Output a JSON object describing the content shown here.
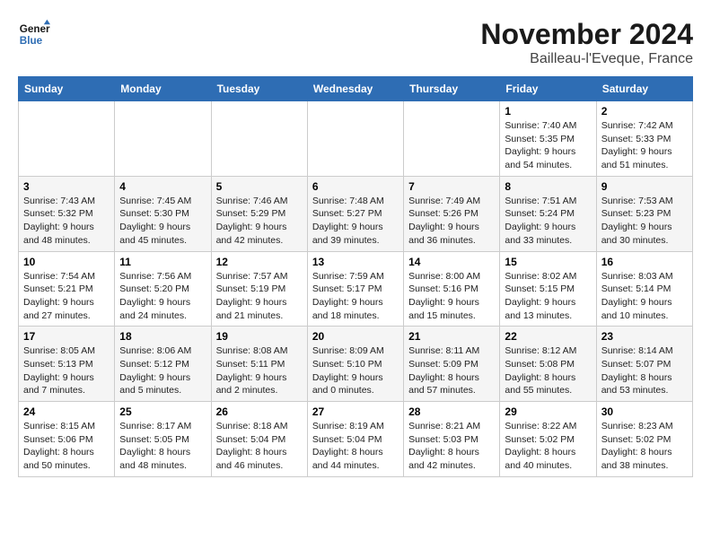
{
  "header": {
    "logo_line1": "General",
    "logo_line2": "Blue",
    "month": "November 2024",
    "location": "Bailleau-l'Eveque, France"
  },
  "weekdays": [
    "Sunday",
    "Monday",
    "Tuesday",
    "Wednesday",
    "Thursday",
    "Friday",
    "Saturday"
  ],
  "weeks": [
    [
      {
        "day": "",
        "info": ""
      },
      {
        "day": "",
        "info": ""
      },
      {
        "day": "",
        "info": ""
      },
      {
        "day": "",
        "info": ""
      },
      {
        "day": "",
        "info": ""
      },
      {
        "day": "1",
        "info": "Sunrise: 7:40 AM\nSunset: 5:35 PM\nDaylight: 9 hours and 54 minutes."
      },
      {
        "day": "2",
        "info": "Sunrise: 7:42 AM\nSunset: 5:33 PM\nDaylight: 9 hours and 51 minutes."
      }
    ],
    [
      {
        "day": "3",
        "info": "Sunrise: 7:43 AM\nSunset: 5:32 PM\nDaylight: 9 hours and 48 minutes."
      },
      {
        "day": "4",
        "info": "Sunrise: 7:45 AM\nSunset: 5:30 PM\nDaylight: 9 hours and 45 minutes."
      },
      {
        "day": "5",
        "info": "Sunrise: 7:46 AM\nSunset: 5:29 PM\nDaylight: 9 hours and 42 minutes."
      },
      {
        "day": "6",
        "info": "Sunrise: 7:48 AM\nSunset: 5:27 PM\nDaylight: 9 hours and 39 minutes."
      },
      {
        "day": "7",
        "info": "Sunrise: 7:49 AM\nSunset: 5:26 PM\nDaylight: 9 hours and 36 minutes."
      },
      {
        "day": "8",
        "info": "Sunrise: 7:51 AM\nSunset: 5:24 PM\nDaylight: 9 hours and 33 minutes."
      },
      {
        "day": "9",
        "info": "Sunrise: 7:53 AM\nSunset: 5:23 PM\nDaylight: 9 hours and 30 minutes."
      }
    ],
    [
      {
        "day": "10",
        "info": "Sunrise: 7:54 AM\nSunset: 5:21 PM\nDaylight: 9 hours and 27 minutes."
      },
      {
        "day": "11",
        "info": "Sunrise: 7:56 AM\nSunset: 5:20 PM\nDaylight: 9 hours and 24 minutes."
      },
      {
        "day": "12",
        "info": "Sunrise: 7:57 AM\nSunset: 5:19 PM\nDaylight: 9 hours and 21 minutes."
      },
      {
        "day": "13",
        "info": "Sunrise: 7:59 AM\nSunset: 5:17 PM\nDaylight: 9 hours and 18 minutes."
      },
      {
        "day": "14",
        "info": "Sunrise: 8:00 AM\nSunset: 5:16 PM\nDaylight: 9 hours and 15 minutes."
      },
      {
        "day": "15",
        "info": "Sunrise: 8:02 AM\nSunset: 5:15 PM\nDaylight: 9 hours and 13 minutes."
      },
      {
        "day": "16",
        "info": "Sunrise: 8:03 AM\nSunset: 5:14 PM\nDaylight: 9 hours and 10 minutes."
      }
    ],
    [
      {
        "day": "17",
        "info": "Sunrise: 8:05 AM\nSunset: 5:13 PM\nDaylight: 9 hours and 7 minutes."
      },
      {
        "day": "18",
        "info": "Sunrise: 8:06 AM\nSunset: 5:12 PM\nDaylight: 9 hours and 5 minutes."
      },
      {
        "day": "19",
        "info": "Sunrise: 8:08 AM\nSunset: 5:11 PM\nDaylight: 9 hours and 2 minutes."
      },
      {
        "day": "20",
        "info": "Sunrise: 8:09 AM\nSunset: 5:10 PM\nDaylight: 9 hours and 0 minutes."
      },
      {
        "day": "21",
        "info": "Sunrise: 8:11 AM\nSunset: 5:09 PM\nDaylight: 8 hours and 57 minutes."
      },
      {
        "day": "22",
        "info": "Sunrise: 8:12 AM\nSunset: 5:08 PM\nDaylight: 8 hours and 55 minutes."
      },
      {
        "day": "23",
        "info": "Sunrise: 8:14 AM\nSunset: 5:07 PM\nDaylight: 8 hours and 53 minutes."
      }
    ],
    [
      {
        "day": "24",
        "info": "Sunrise: 8:15 AM\nSunset: 5:06 PM\nDaylight: 8 hours and 50 minutes."
      },
      {
        "day": "25",
        "info": "Sunrise: 8:17 AM\nSunset: 5:05 PM\nDaylight: 8 hours and 48 minutes."
      },
      {
        "day": "26",
        "info": "Sunrise: 8:18 AM\nSunset: 5:04 PM\nDaylight: 8 hours and 46 minutes."
      },
      {
        "day": "27",
        "info": "Sunrise: 8:19 AM\nSunset: 5:04 PM\nDaylight: 8 hours and 44 minutes."
      },
      {
        "day": "28",
        "info": "Sunrise: 8:21 AM\nSunset: 5:03 PM\nDaylight: 8 hours and 42 minutes."
      },
      {
        "day": "29",
        "info": "Sunrise: 8:22 AM\nSunset: 5:02 PM\nDaylight: 8 hours and 40 minutes."
      },
      {
        "day": "30",
        "info": "Sunrise: 8:23 AM\nSunset: 5:02 PM\nDaylight: 8 hours and 38 minutes."
      }
    ]
  ]
}
